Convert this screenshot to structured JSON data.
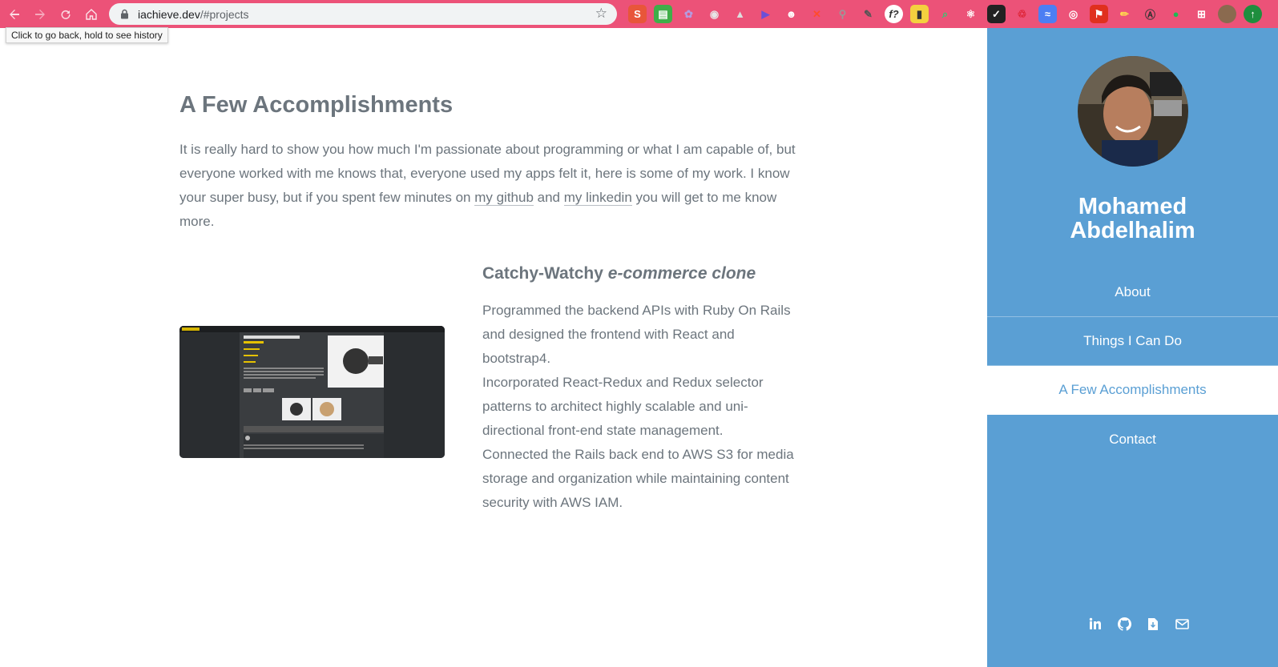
{
  "browser": {
    "url_host": "iachieve.dev",
    "url_path": "/#projects",
    "tooltip": "Click to go back, hold to see history"
  },
  "main": {
    "title": "A Few Accomplishments",
    "intro_part1": "It is really hard to show you how much I'm passionate about programming or what I am capable of, but everyone worked with me knows that, everyone used my apps felt it, here is some of my work. I know your super busy, but if you spent few minutes on ",
    "github_link": "my github",
    "intro_and": " and ",
    "linkedin_link": "my linkedin",
    "intro_part2": " you will get to me know more.",
    "project": {
      "title_plain": "Catchy-Watchy ",
      "title_em": "e-commerce clone",
      "desc_1": "Programmed the backend APIs with Ruby On Rails and designed the frontend with React and bootstrap4.",
      "desc_2": "Incorporated React-Redux and Redux selector patterns to architect highly scalable and uni-directional front-end state management.",
      "desc_3": "Connected the Rails back end to AWS S3 for media storage and organization while maintaining content security with AWS IAM."
    }
  },
  "sidebar": {
    "name_line1": "Mohamed",
    "name_line2": "Abdelhalim",
    "menu": [
      {
        "label": "About"
      },
      {
        "label": "Things I Can Do"
      },
      {
        "label": "A Few Accomplishments"
      },
      {
        "label": "Contact"
      }
    ],
    "social_icons": [
      "linkedin-icon",
      "github-icon",
      "resume-icon",
      "email-icon"
    ]
  },
  "colors": {
    "browser_bar": "#ec5278",
    "sidebar": "#5a9fd4",
    "text": "#6c757d"
  }
}
